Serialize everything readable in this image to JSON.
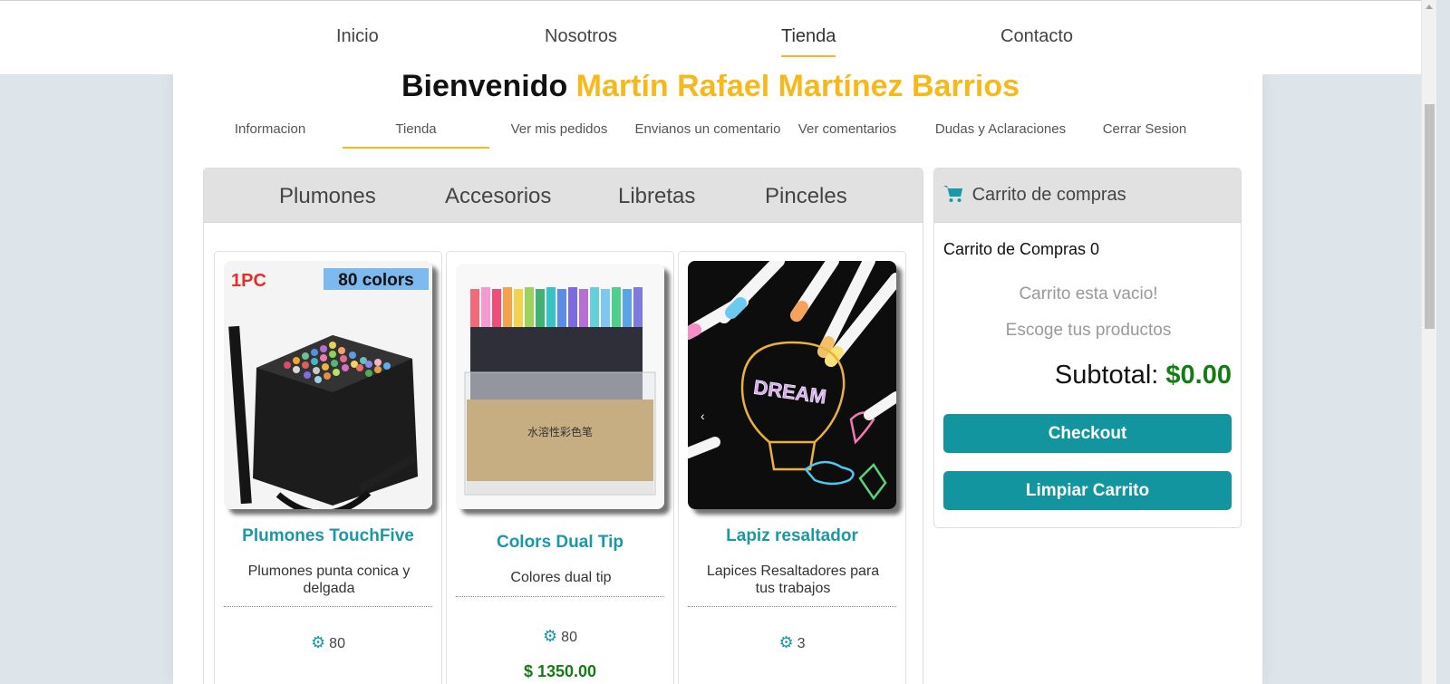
{
  "topnav": {
    "items": [
      {
        "label": "Inicio"
      },
      {
        "label": "Nosotros"
      },
      {
        "label": "Tienda",
        "active": true
      },
      {
        "label": "Contacto"
      }
    ]
  },
  "welcome": {
    "greeting": "Bienvenido",
    "name": "Martín Rafael Martínez Barrios"
  },
  "subnav": {
    "items": [
      {
        "label": "Informacion"
      },
      {
        "label": "Tienda",
        "active": true
      },
      {
        "label": "Ver mis pedidos"
      },
      {
        "label": "Envianos un comentario"
      },
      {
        "label": "Ver comentarios"
      },
      {
        "label": "Dudas y Aclaraciones"
      },
      {
        "label": "Cerrar Sesion"
      }
    ]
  },
  "categories": [
    "Plumones",
    "Accesorios",
    "Libretas",
    "Pinceles"
  ],
  "products": [
    {
      "name": "Plumones TouchFive",
      "description": "Plumones punta conica y delgada",
      "stock": "80",
      "image_badge_left": "1PC",
      "image_badge_right": "80 colors"
    },
    {
      "name": "Colors Dual Tip",
      "description": "Colores dual tip",
      "stock": "80",
      "price": "$ 1350.00"
    },
    {
      "name": "Lapiz resaltador",
      "description": "Lapices Resaltadores para tus trabajos",
      "stock": "3",
      "image_text": "DREAM"
    }
  ],
  "cart": {
    "title": "Carrito de compras",
    "count_label": "Carrito de Compras 0",
    "empty_line1": "Carrito esta vacio!",
    "empty_line2": "Escoge tus productos",
    "subtotal_label": "Subtotal:",
    "subtotal_value": "$0.00",
    "checkout_label": "Checkout",
    "clear_label": "Limpiar Carrito"
  },
  "colors": {
    "accent_yellow": "#f7b81c",
    "teal": "#13959f",
    "green_price": "#147c14"
  }
}
